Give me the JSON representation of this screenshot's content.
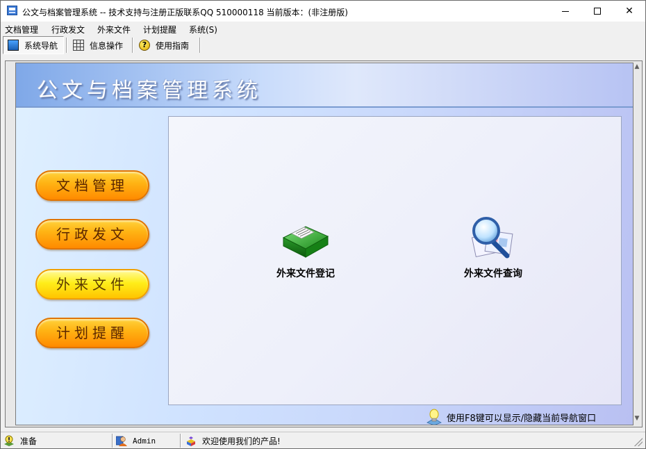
{
  "window": {
    "title": "公文与档案管理系统 -- 技术支持与注册正版联系QQ 510000118    当前版本：(非注册版)"
  },
  "menu": {
    "items": [
      "文档管理",
      "行政发文",
      "外来文件",
      "计划提醒",
      "系统(S)"
    ]
  },
  "toolbar": {
    "nav_label": "系统导航",
    "info_label": "信息操作",
    "help_label": "使用指南"
  },
  "header": {
    "title": "公文与档案管理系统"
  },
  "sidebar": {
    "buttons": [
      "文档管理",
      "行政发文",
      "外来文件",
      "计划提醒"
    ],
    "selected": "外来文件"
  },
  "content": {
    "features": [
      {
        "label": "外来文件登记",
        "icon": "green-book-icon"
      },
      {
        "label": "外来文件查询",
        "icon": "magnifier-documents-icon"
      }
    ]
  },
  "hint": {
    "text": "使用F8键可以显示/隐藏当前导航窗口"
  },
  "status": {
    "ready": "准备",
    "user": "Admin",
    "welcome": "欢迎使用我们的产品!"
  },
  "colors": {
    "button_orange": "#ffb414",
    "button_selected": "#ffee1a",
    "panel_blue": "#cfe2ff"
  }
}
